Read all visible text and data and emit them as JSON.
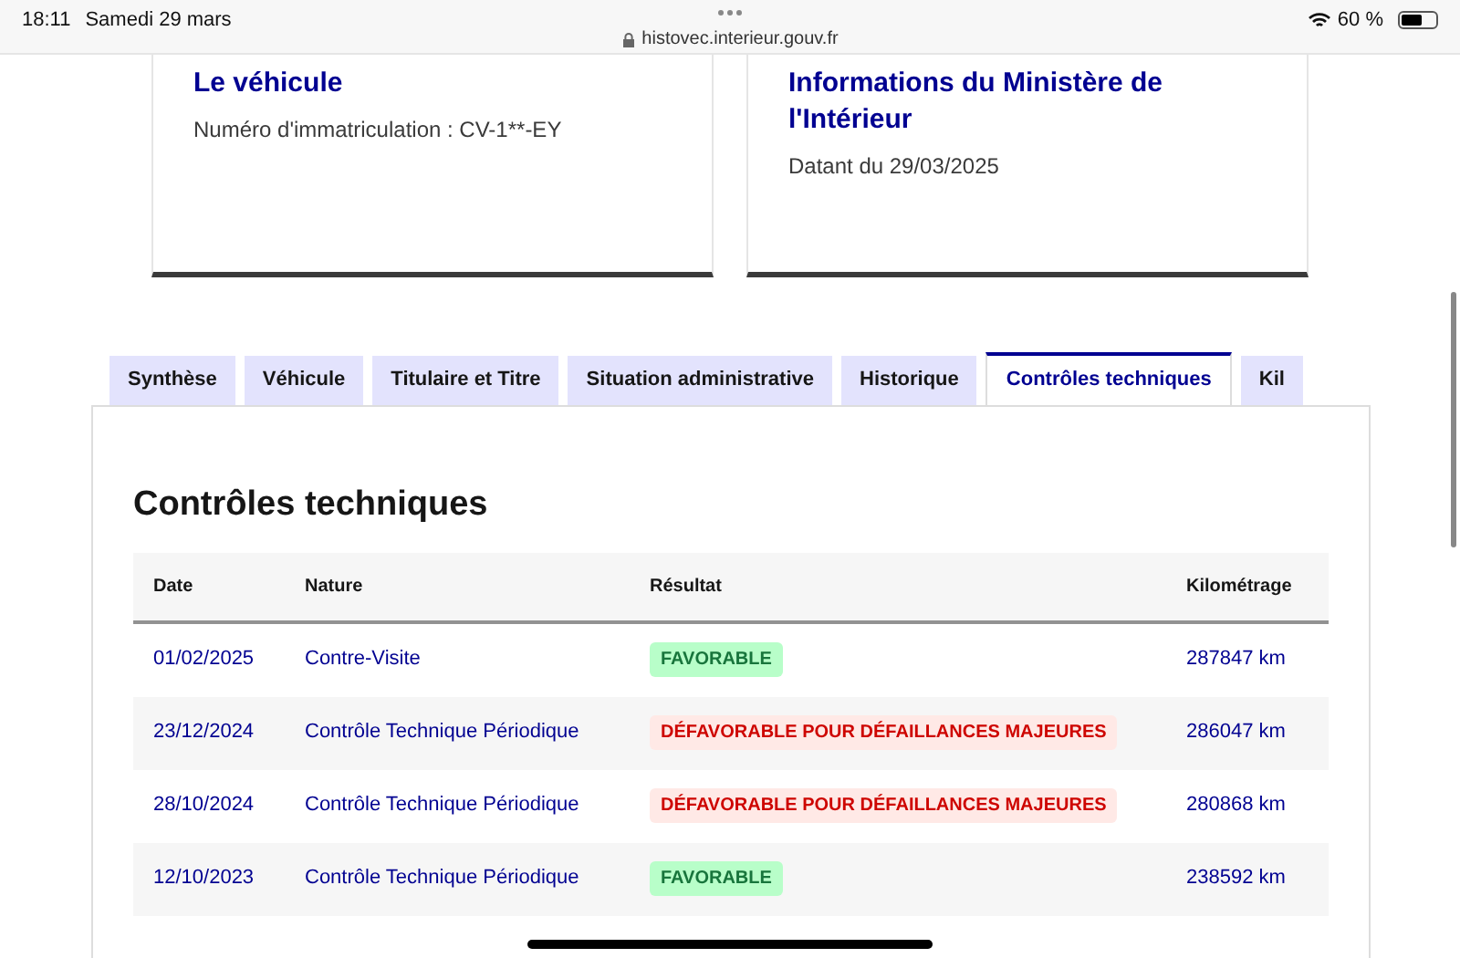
{
  "status_bar": {
    "time": "18:11",
    "date": "Samedi 29 mars",
    "url": "histovec.interieur.gouv.fr",
    "battery_text": "60 %",
    "battery": {
      "level": 0.6
    }
  },
  "cards": [
    {
      "title": "Le véhicule",
      "text": "Numéro d'immatriculation : CV-1**-EY"
    },
    {
      "title": "Informations du Ministère de l'Intérieur",
      "text": "Datant du 29/03/2025"
    }
  ],
  "tabs": [
    {
      "label": "Synthèse",
      "selected": false
    },
    {
      "label": "Véhicule",
      "selected": false
    },
    {
      "label": "Titulaire et Titre",
      "selected": false
    },
    {
      "label": "Situation administrative",
      "selected": false
    },
    {
      "label": "Historique",
      "selected": false
    },
    {
      "label": "Contrôles techniques",
      "selected": true
    },
    {
      "label": "Kil",
      "selected": false
    }
  ],
  "section_title": "Contrôles techniques",
  "table": {
    "columns": [
      "Date",
      "Nature",
      "Résultat",
      "Kilométrage"
    ],
    "rows": [
      {
        "date": "01/02/2025",
        "nature": "Contre-Visite",
        "result": {
          "text": "FAVORABLE",
          "kind": "success"
        },
        "mileage": "287847 km"
      },
      {
        "date": "23/12/2024",
        "nature": "Contrôle Technique Périodique",
        "result": {
          "text": "DÉFAVORABLE POUR DÉFAILLANCES MAJEURES",
          "kind": "error"
        },
        "mileage": "286047 km"
      },
      {
        "date": "28/10/2024",
        "nature": "Contrôle Technique Périodique",
        "result": {
          "text": "DÉFAVORABLE POUR DÉFAILLANCES MAJEURES",
          "kind": "error"
        },
        "mileage": "280868 km"
      },
      {
        "date": "12/10/2023",
        "nature": "Contrôle Technique Périodique",
        "result": {
          "text": "FAVORABLE",
          "kind": "success"
        },
        "mileage": "238592 km"
      }
    ]
  }
}
